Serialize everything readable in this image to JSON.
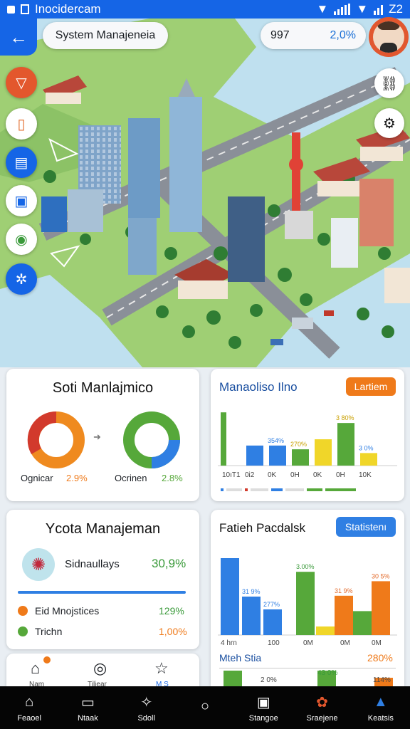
{
  "status_bar": {
    "carrier": "Inocidercam",
    "time": "Z2"
  },
  "header": {
    "title": "System Manajeneia",
    "stat_value_a": "997",
    "stat_value_b": "2,0%"
  },
  "cards": {
    "soti": {
      "title": "Soti Manlajmico",
      "left_label": "Ognicar",
      "left_value": "2.9%",
      "right_label": "Ocrinen",
      "right_value": "2.8%"
    },
    "manaoliso": {
      "title": "Manaoliso Ilno",
      "button": "Lartiem",
      "bar_labels": [
        "3 80%",
        "354%",
        "270%",
        "3 0%"
      ],
      "x_labels": [
        "10ıT1",
        "0i2",
        "0K",
        "0H",
        "0K",
        "0H",
        "10K"
      ]
    },
    "ycota": {
      "title": "Ycota Manajeman",
      "row1_label": "Sidnaullays",
      "row1_value": "30,9%",
      "row2_label": "Eid Mnojstices",
      "row2_value": "129%",
      "row3_label": "Trichn",
      "row3_value": "1,00%"
    },
    "fatieh": {
      "title": "Fatieh Pacdalsk",
      "button": "Statistenı",
      "bar_labels": [
        "31 9%",
        "277%",
        "3.00%",
        "31 9%",
        "30 5%"
      ],
      "x_labels": [
        "4 hrn",
        "100",
        "0M",
        "0M",
        "0M"
      ],
      "sub_title": "Mteh Stia",
      "sub_value": "280%",
      "sub_bar_labels": [
        "2 0%",
        "43 0%",
        "114%"
      ]
    },
    "mini_nav": {
      "item1": "Nam",
      "item2": "Tiliear",
      "item3": "M S"
    }
  },
  "bottom_nav": [
    {
      "label": "Feaoel"
    },
    {
      "label": "Ntaak"
    },
    {
      "label": "Sdoll"
    },
    {
      "label": ""
    },
    {
      "label": "Stangoe"
    },
    {
      "label": "Sraejene"
    },
    {
      "label": "Keatsis"
    }
  ],
  "chart_data": [
    {
      "type": "bar",
      "title": "Manaoliso Ilno",
      "categories": [
        "10ıT1",
        "0i2",
        "0K",
        "0H",
        "0K",
        "0H",
        "10K"
      ],
      "values": [
        85,
        32,
        32,
        26,
        42,
        68,
        20
      ],
      "ylim": [
        0,
        100
      ]
    },
    {
      "type": "bar",
      "title": "Fatieh Pacdalsk",
      "categories": [
        "4 hrn",
        "100",
        "0M",
        "0M",
        "0M"
      ],
      "values": [
        90,
        45,
        30,
        74,
        10,
        46,
        28,
        63
      ],
      "ylim": [
        0,
        100
      ]
    }
  ],
  "colors": {
    "accent": "#1565e6",
    "orange": "#ef7a1a",
    "green": "#56a83a",
    "red": "#d23a2c",
    "yellow": "#f0d629",
    "blue": "#2f7fe3"
  }
}
